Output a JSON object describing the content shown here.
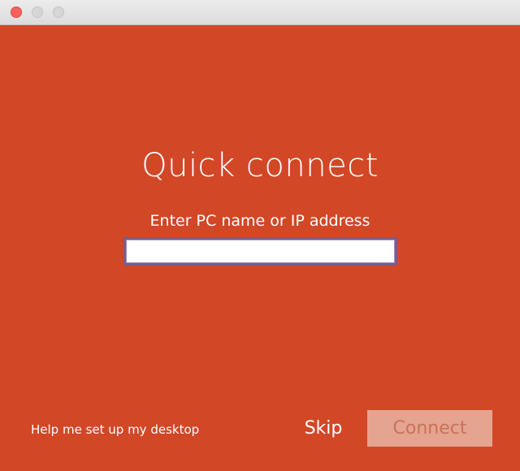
{
  "window": {
    "title_bar": {
      "buttons": [
        "close",
        "minimize",
        "maximize"
      ]
    }
  },
  "main": {
    "title": "Quick connect",
    "field_label": "Enter PC name or IP address",
    "pc_input_value": ""
  },
  "footer": {
    "help_link": "Help me set up my desktop",
    "skip_label": "Skip",
    "connect_label": "Connect"
  },
  "colors": {
    "background": "#d24726",
    "connect_disabled_bg": "#e5a490",
    "connect_disabled_text": "#c9725a",
    "input_border": "#7a5c8a",
    "close_button": "#fc605c"
  }
}
